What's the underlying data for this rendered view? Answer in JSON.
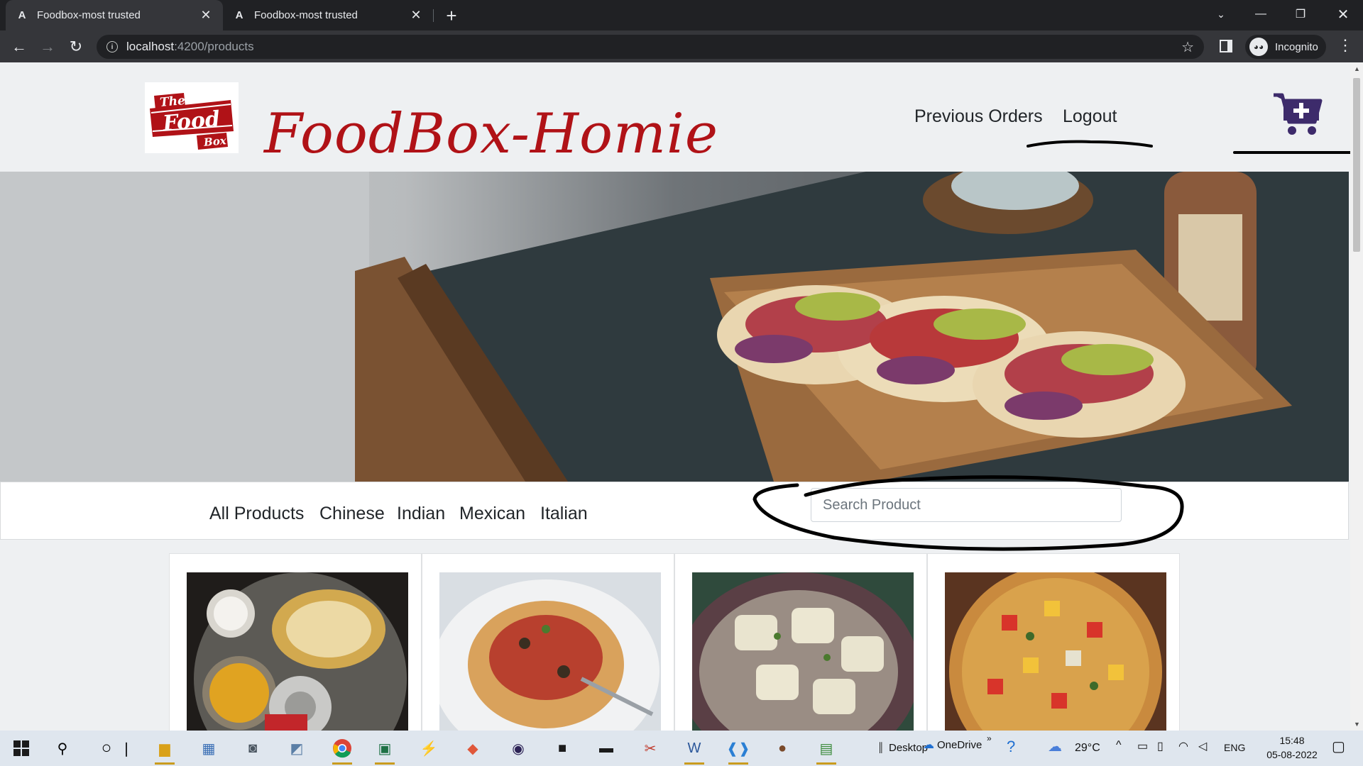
{
  "browser": {
    "tabs": [
      {
        "title": "Foodbox-most trusted",
        "favicon": "angular-icon",
        "active": true
      },
      {
        "title": "Foodbox-most trusted",
        "favicon": "angular-icon",
        "active": false
      }
    ],
    "url_host": "localhost",
    "url_path": ":4200/products",
    "profile_label": "Incognito"
  },
  "page": {
    "logo": {
      "line1": "The",
      "line2": "Food",
      "line3": "Box"
    },
    "brand": "FoodBox-Homie",
    "nav": {
      "previous_orders": "Previous Orders",
      "logout": "Logout"
    },
    "categories": [
      "All Products",
      "Chinese",
      "Indian",
      "Mexican",
      "Italian"
    ],
    "search": {
      "placeholder": "Search Product",
      "value": ""
    },
    "products": [
      {
        "image": "indian-thali-image"
      },
      {
        "image": "spaghetti-image"
      },
      {
        "image": "ravioli-image"
      },
      {
        "image": "pizza-image"
      }
    ],
    "colors": {
      "brand_red": "#b01217",
      "cart_purple": "#3d2b6b"
    }
  },
  "taskbar": {
    "desktop_label": "Desktop",
    "onedrive_label": "OneDrive",
    "weather": "29°C",
    "language": "ENG",
    "time": "15:48",
    "date": "05-08-2022"
  }
}
